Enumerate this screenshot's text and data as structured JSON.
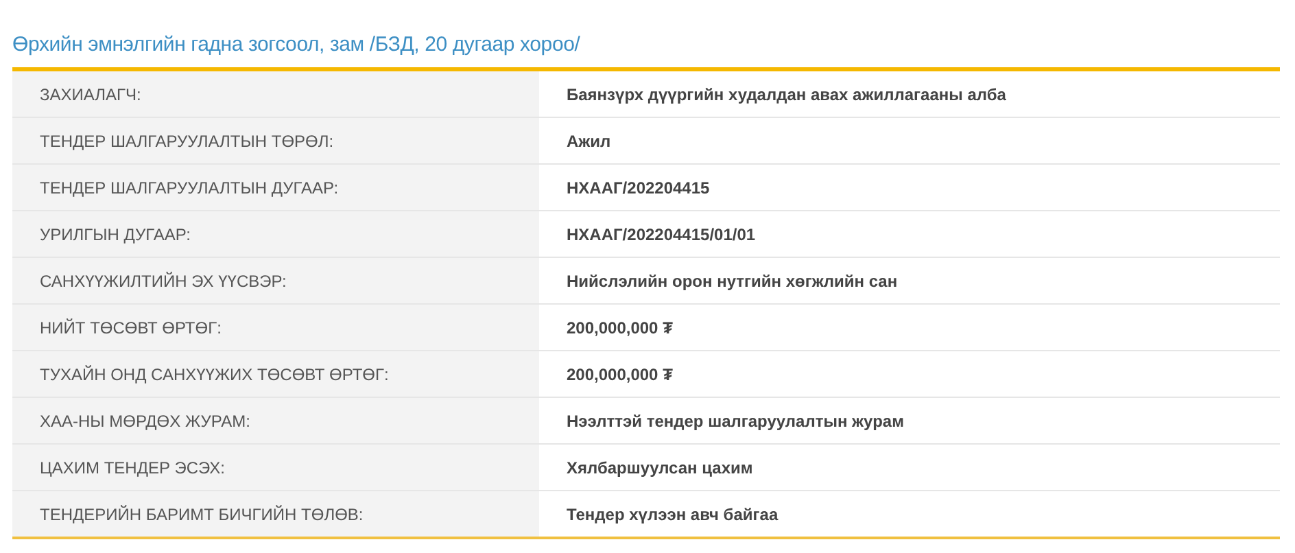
{
  "title": "Өрхийн эмнэлгийн гадна зогсоол, зам /БЗД, 20 дугаар хороо/",
  "rows": [
    {
      "label": "ЗАХИАЛАГЧ:",
      "value": "Баянзүрх дүүргийн худалдан авах ажиллагааны алба"
    },
    {
      "label": "ТЕНДЕР ШАЛГАРУУЛАЛТЫН ТӨРӨЛ:",
      "value": "Ажил"
    },
    {
      "label": "ТЕНДЕР ШАЛГАРУУЛАЛТЫН ДУГААР:",
      "value": "НХААГ/202204415"
    },
    {
      "label": "УРИЛГЫН ДУГААР:",
      "value": "НХААГ/202204415/01/01"
    },
    {
      "label": "САНХҮҮЖИЛТИЙН ЭХ ҮҮСВЭР:",
      "value": "Нийслэлийн орон нутгийн хөгжлийн сан"
    },
    {
      "label": "НИЙТ ТӨСӨВТ ӨРТӨГ:",
      "value": "200,000,000 ₮"
    },
    {
      "label": "ТУХАЙН ОНД САНХҮҮЖИХ ТӨСӨВТ ӨРТӨГ:",
      "value": "200,000,000 ₮"
    },
    {
      "label": "ХАА-НЫ МӨРДӨХ ЖУРАМ:",
      "value": "Нээлттэй тендер шалгаруулалтын журам"
    },
    {
      "label": "ЦАХИМ ТЕНДЕР ЭСЭХ:",
      "value": "Хялбаршуулсан цахим"
    },
    {
      "label": "ТЕНДЕРИЙН БАРИМТ БИЧГИЙН ТӨЛӨВ:",
      "value": "Тендер хүлээн авч байгаа"
    }
  ]
}
